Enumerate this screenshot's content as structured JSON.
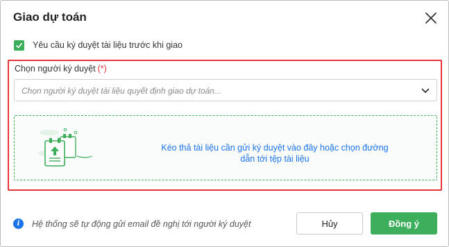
{
  "dialog": {
    "title": "Giao dự toán",
    "close_icon": "close-icon"
  },
  "require_signature": {
    "checked": true,
    "label": "Yêu cầu ký duyệt tài liệu trước khi giao"
  },
  "signer": {
    "label": "Chọn người ký duyệt",
    "required_mark": "(*)",
    "placeholder": "Chọn người ký duyệt tài liệu quyết định giao dự toán...",
    "dropdown_icon": "chevron-down-icon"
  },
  "upload": {
    "illustration": "document-upload-icon",
    "text_line1": "Kéo thả tài liệu cần gửi ký duyệt vào đây hoặc chọn đường",
    "text_line2": "dẫn tới tệp tài liệu"
  },
  "footer": {
    "info_icon": "info-icon",
    "info_text": "Hệ thống sẽ tự động gửi email đề nghị tới người ký duyệt",
    "cancel_label": "Hủy",
    "ok_label": "Đồng ý"
  },
  "colors": {
    "accent": "#3dae5b",
    "highlight": "#e8323a",
    "link": "#1a73e8"
  }
}
